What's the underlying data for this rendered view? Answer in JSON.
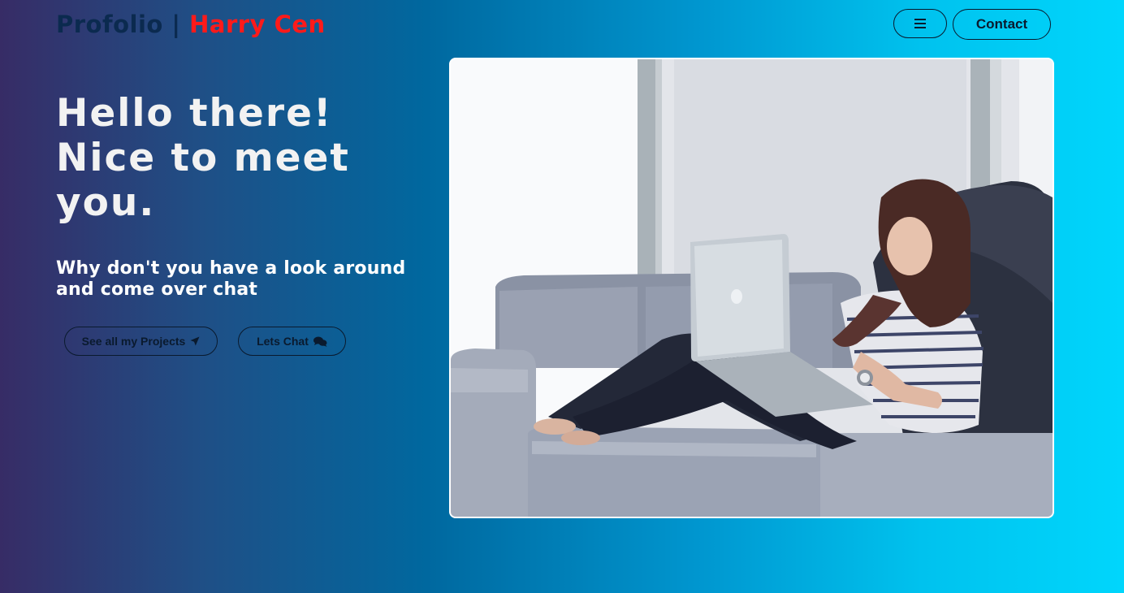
{
  "header": {
    "logo_brand": "Profolio",
    "logo_separator": " | ",
    "logo_owner": "Harry Cen",
    "menu_icon": "hamburger-icon",
    "contact_label": "Contact"
  },
  "hero": {
    "title": "Hello there! Nice to meet you.",
    "subtitle": "Why don't you have a look around and come over chat",
    "projects_button": "See all my Projects",
    "projects_icon": "paper-plane-icon",
    "chat_button": "Lets Chat",
    "chat_icon": "chat-bubbles-icon",
    "image_subject": "woman-on-sofa-with-laptop"
  },
  "colors": {
    "gradient_start": "#372c66",
    "gradient_end": "#00d6fc",
    "logo_brand": "#0b2a4f",
    "logo_owner": "#ff1a1a",
    "text_light": "#f2f2f2",
    "outline": "#0a1a2e"
  }
}
